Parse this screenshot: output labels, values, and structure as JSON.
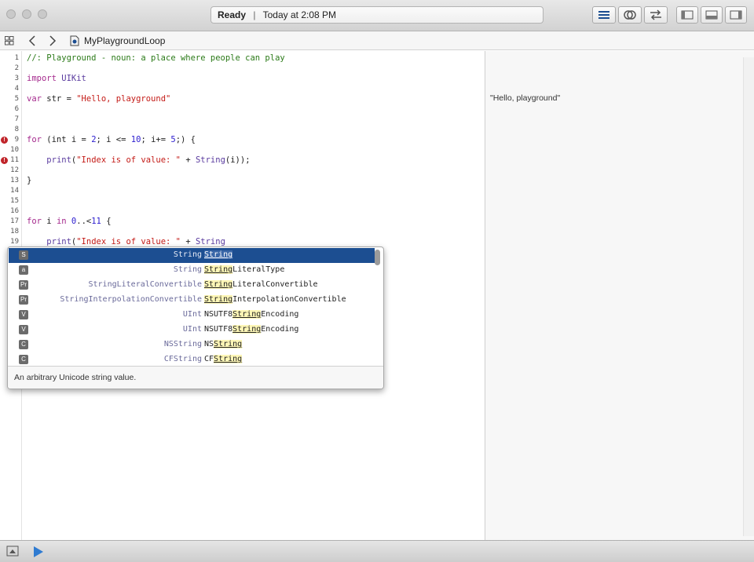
{
  "toolbar": {
    "status": "Ready",
    "time": "Today at 2:08 PM"
  },
  "jumpbar": {
    "filename": "MyPlaygroundLoop"
  },
  "editor": {
    "lines": [
      {
        "num": "1",
        "text": "//: Playground - noun: a place where people can play"
      },
      {
        "num": "2",
        "text": ""
      },
      {
        "num": "3",
        "text": "import UIKit"
      },
      {
        "num": "4",
        "text": ""
      },
      {
        "num": "5",
        "text": "var str = \"Hello, playground\""
      },
      {
        "num": "6",
        "text": ""
      },
      {
        "num": "7",
        "text": ""
      },
      {
        "num": "8",
        "text": ""
      },
      {
        "num": "9",
        "text": "for (int i = 2; i <= 10; i+= 5;) {"
      },
      {
        "num": "10",
        "text": ""
      },
      {
        "num": "11",
        "text": "    print(\"Index is of value: \" + String(i));"
      },
      {
        "num": "12",
        "text": ""
      },
      {
        "num": "13",
        "text": "}"
      },
      {
        "num": "14",
        "text": ""
      },
      {
        "num": "15",
        "text": ""
      },
      {
        "num": "16",
        "text": ""
      },
      {
        "num": "17",
        "text": "for i in 0..<11 {"
      },
      {
        "num": "18",
        "text": ""
      },
      {
        "num": "19",
        "text": "    print(\"Index is of value: \" + String"
      }
    ]
  },
  "results": {
    "line5": "\"Hello, playground\""
  },
  "completion": {
    "items": [
      {
        "badge": "S",
        "type": "String",
        "name_hl": "String",
        "name_rest": "",
        "name_prefix": ""
      },
      {
        "badge": "a",
        "type": "String",
        "name_hl": "String",
        "name_rest": "LiteralType",
        "name_prefix": ""
      },
      {
        "badge": "Pr",
        "type": "StringLiteralConvertible",
        "name_hl": "String",
        "name_rest": "LiteralConvertible",
        "name_prefix": ""
      },
      {
        "badge": "Pr",
        "type": "StringInterpolationConvertible",
        "name_hl": "String",
        "name_rest": "InterpolationConvertible",
        "name_prefix": ""
      },
      {
        "badge": "V",
        "type": "UInt",
        "name_prefix": "NSUTF8",
        "name_hl": "String",
        "name_rest": "Encoding"
      },
      {
        "badge": "V",
        "type": "UInt",
        "name_prefix": "NSUTF8",
        "name_hl": "String",
        "name_rest": "Encoding"
      },
      {
        "badge": "C",
        "type": "NSString",
        "name_prefix": "NS",
        "name_hl": "String",
        "name_rest": ""
      },
      {
        "badge": "C",
        "type": "CFString",
        "name_prefix": "CF",
        "name_hl": "String",
        "name_rest": ""
      }
    ],
    "description": "An arbitrary Unicode string value."
  }
}
